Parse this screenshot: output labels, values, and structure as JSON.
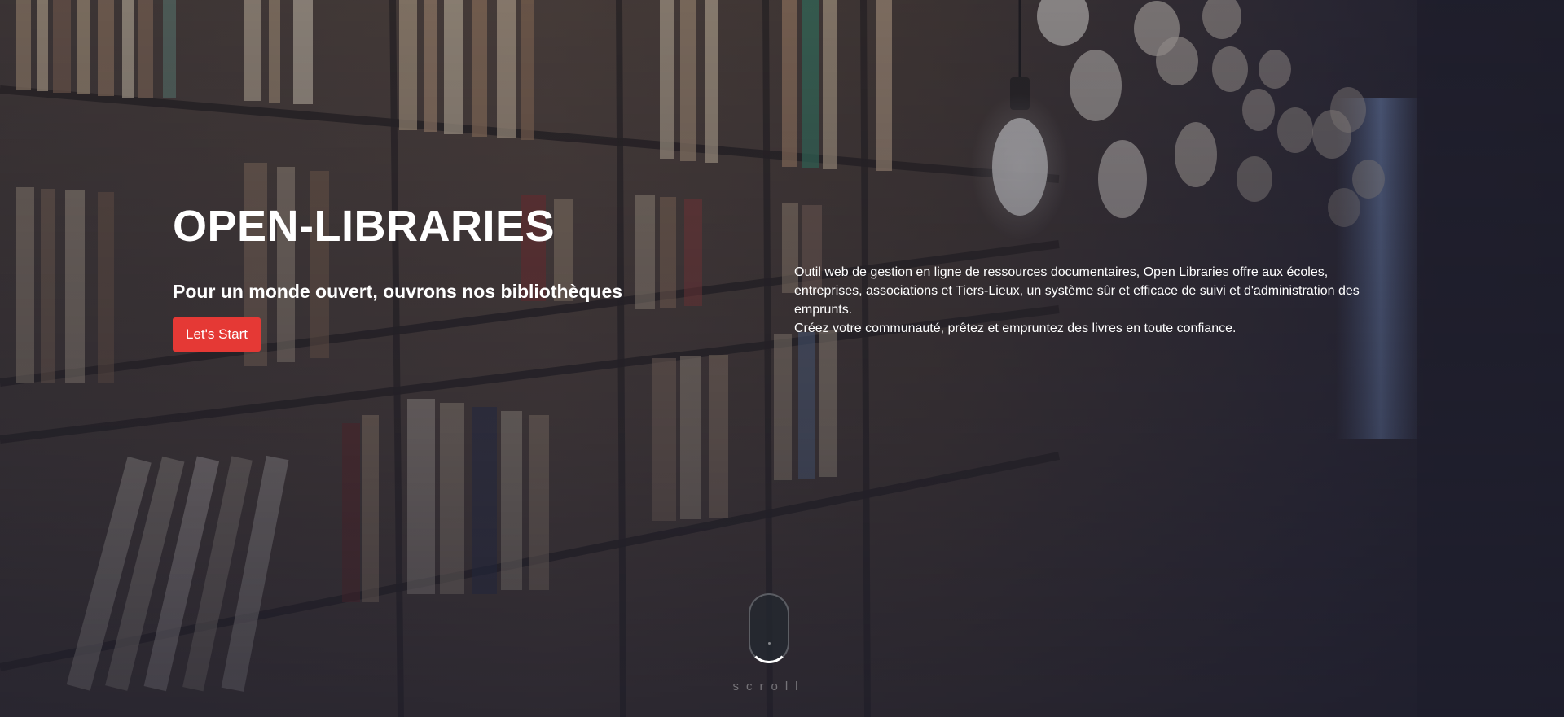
{
  "hero": {
    "title": "OPEN-LIBRARIES",
    "subtitle": "Pour un monde ouvert, ouvrons nos bibliothèques",
    "cta_label": "Let's Start",
    "description_line1": "Outil web de gestion en ligne de ressources documentaires, Open Libraries offre aux écoles, entreprises, associations et Tiers-Lieux, un système sûr et efficace de suivi et d'administration des emprunts.",
    "description_line2": "Créez votre communauté, prêtez et empruntez des livres en toute confiance.",
    "scroll_label": "scroll"
  },
  "colors": {
    "accent": "#e53935",
    "text": "#ffffff",
    "overlay": "#1e1e2d"
  },
  "icons": {
    "scroll_indicator": "mouse-scroll-icon"
  }
}
